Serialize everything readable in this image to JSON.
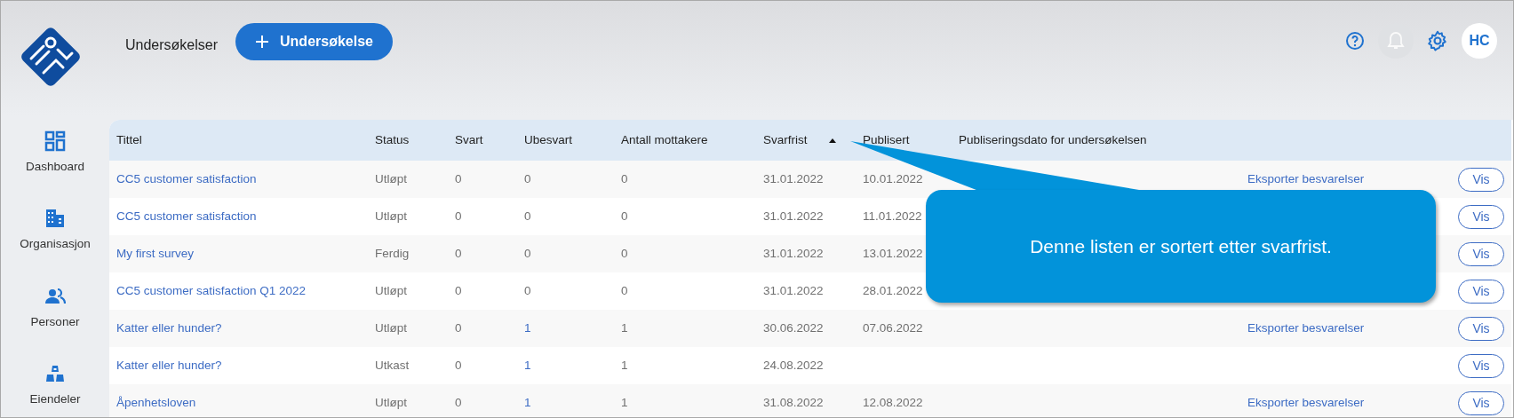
{
  "header": {
    "title": "Undersøkelser",
    "new_button": "Undersøkelse"
  },
  "topbar": {
    "notifications": {
      "disabled": true
    },
    "avatar": "HC"
  },
  "sidebar": {
    "items": [
      {
        "label": "Dashboard"
      },
      {
        "label": "Organisasjon"
      },
      {
        "label": "Personer"
      },
      {
        "label": "Eiendeler"
      }
    ]
  },
  "table": {
    "columns": [
      {
        "label": "Tittel",
        "sorted": false
      },
      {
        "label": "Status",
        "sorted": false
      },
      {
        "label": "Svart",
        "sorted": false
      },
      {
        "label": "Ubesvart",
        "sorted": false
      },
      {
        "label": "Antall mottakere",
        "sorted": false
      },
      {
        "label": "Svarfrist",
        "sorted": true
      },
      {
        "label": "Publisert",
        "sorted": false
      },
      {
        "label": "Publiseringsdato for undersøkelsen",
        "sorted": false
      }
    ],
    "rows": [
      {
        "title": "CC5 customer satisfaction",
        "status": "Utløpt",
        "svart": "0",
        "ubesvart": "0",
        "ubesvart_link": false,
        "mottakere": "0",
        "svarfrist": "31.01.2022",
        "publisert": "10.01.2022",
        "export": "Eksporter besvarelser",
        "view": "Vis"
      },
      {
        "title": "CC5 customer satisfaction",
        "status": "Utløpt",
        "svart": "0",
        "ubesvart": "0",
        "ubesvart_link": false,
        "mottakere": "0",
        "svarfrist": "31.01.2022",
        "publisert": "11.01.2022",
        "view": "Vis"
      },
      {
        "title": "My first survey",
        "status": "Ferdig",
        "svart": "0",
        "ubesvart": "0",
        "ubesvart_link": false,
        "mottakere": "0",
        "svarfrist": "31.01.2022",
        "publisert": "13.01.2022",
        "view": "Vis"
      },
      {
        "title": "CC5 customer satisfaction Q1 2022",
        "status": "Utløpt",
        "svart": "0",
        "ubesvart": "0",
        "ubesvart_link": false,
        "mottakere": "0",
        "svarfrist": "31.01.2022",
        "publisert": "28.01.2022",
        "view": "Vis"
      },
      {
        "title": "Katter eller hunder?",
        "status": "Utløpt",
        "svart": "0",
        "ubesvart": "1",
        "ubesvart_link": true,
        "mottakere": "1",
        "svarfrist": "30.06.2022",
        "publisert": "07.06.2022",
        "export": "Eksporter besvarelser",
        "view": "Vis"
      },
      {
        "title": "Katter eller hunder?",
        "status": "Utkast",
        "svart": "0",
        "ubesvart": "1",
        "ubesvart_link": true,
        "mottakere": "1",
        "svarfrist": "24.08.2022",
        "view": "Vis"
      },
      {
        "title": "Åpenhetsloven",
        "status": "Utløpt",
        "svart": "0",
        "ubesvart": "1",
        "ubesvart_link": true,
        "mottakere": "1",
        "svarfrist": "31.08.2022",
        "publisert": "12.08.2022",
        "export": "Eksporter besvarelser",
        "view": "Vis"
      }
    ]
  },
  "callout": {
    "text": "Denne listen er sortert etter svarfrist."
  }
}
